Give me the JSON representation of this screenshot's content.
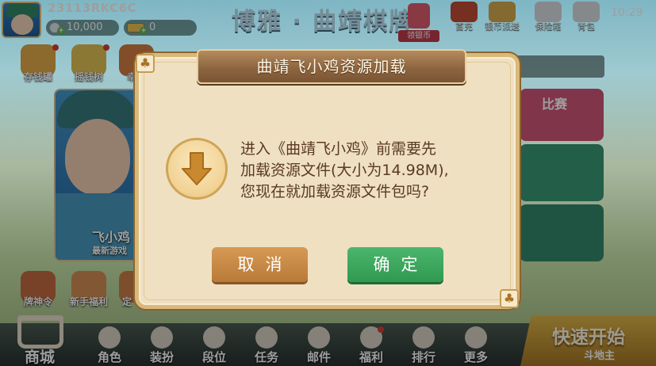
{
  "topbar": {
    "player_id": "23113RKC6C",
    "silver_balance": "10,000",
    "gold_balance": "0",
    "app_title": "博雅 · 曲靖棋牌",
    "claim_silver_label": "领银币",
    "clock": "10:29",
    "icons": [
      {
        "id": "first-recharge",
        "label": "首充"
      },
      {
        "id": "silver-dispatch",
        "label": "银币派送"
      },
      {
        "id": "safe-box",
        "label": "保险箱"
      },
      {
        "id": "backpack",
        "label": "背包"
      }
    ]
  },
  "left_menu": {
    "items": [
      {
        "label": "存钱罐"
      },
      {
        "label": "摇钱树"
      },
      {
        "label": "幸运"
      }
    ],
    "bottom_items": [
      {
        "label": "牌神令"
      },
      {
        "label": "新手福利"
      },
      {
        "label": "定"
      }
    ]
  },
  "banner": {
    "title": "飞小鸡",
    "subtitle": "最新游戏"
  },
  "game_tiles": {
    "bisai_label": "比赛"
  },
  "bottom_nav": {
    "shop_label": "商城",
    "items": [
      {
        "label": "角色",
        "icon": "person-icon"
      },
      {
        "label": "装扮",
        "icon": "shirt-icon"
      },
      {
        "label": "段位",
        "icon": "rank-icon"
      },
      {
        "label": "任务",
        "icon": "task-icon"
      },
      {
        "label": "邮件",
        "icon": "mail-icon"
      },
      {
        "label": "福利",
        "icon": "gift-icon"
      },
      {
        "label": "排行",
        "icon": "ranking-icon"
      },
      {
        "label": "更多",
        "icon": "more-icon"
      }
    ],
    "quick_start_label": "快速开始",
    "quick_start_sub": "斗地主"
  },
  "dialog": {
    "title": "曲靖飞小鸡资源加载",
    "message_lines": [
      "进入《曲靖飞小鸡》前需要先",
      "加载资源文件(大小为14.98M),",
      "您现在就加载资源文件包吗?"
    ],
    "cancel_label": "取消",
    "confirm_label": "确定",
    "corner_symbol": "♣"
  },
  "colors": {
    "dialog_bg": "#efe0c2",
    "dialog_border": "#d9b97a",
    "title_ribbon": "#8d6540",
    "cancel_button": "#c98a45",
    "confirm_button": "#3aa65b",
    "message_text": "#5a3a22"
  }
}
